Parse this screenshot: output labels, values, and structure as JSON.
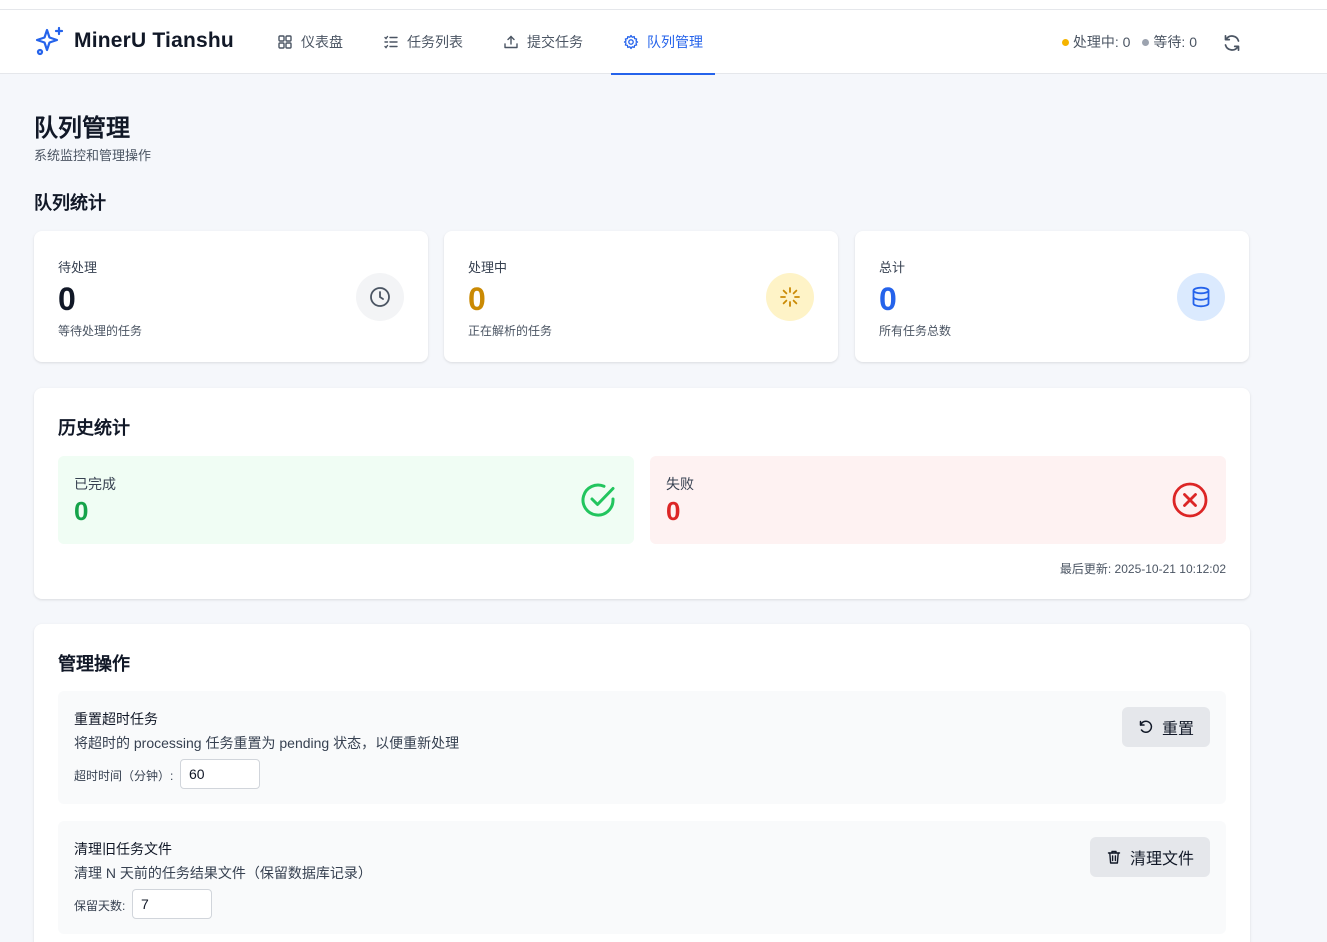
{
  "app": {
    "name": "MinerU Tianshu"
  },
  "nav": {
    "items": [
      {
        "label": "仪表盘",
        "icon": "dashboard-icon"
      },
      {
        "label": "任务列表",
        "icon": "list-icon"
      },
      {
        "label": "提交任务",
        "icon": "upload-icon"
      },
      {
        "label": "队列管理",
        "icon": "gear-icon",
        "active": true
      }
    ]
  },
  "header_status": {
    "processing": "处理中: 0",
    "pending": "等待: 0",
    "processing_color": "#f5b400",
    "pending_color": "#9ca3af"
  },
  "page": {
    "title": "队列管理",
    "subtitle": "系统监控和管理操作"
  },
  "queue_stats": {
    "title": "队列统计",
    "cards": [
      {
        "label": "待处理",
        "value": "0",
        "desc": "等待处理的任务",
        "icon": "clock-icon",
        "color": "#111827",
        "icon_bg": "#f3f4f6",
        "icon_color": "#4b5563"
      },
      {
        "label": "处理中",
        "value": "0",
        "desc": "正在解析的任务",
        "icon": "loader-icon",
        "color": "#ca8a04",
        "icon_bg": "#fef3c7",
        "icon_color": "#ca8a04"
      },
      {
        "label": "总计",
        "value": "0",
        "desc": "所有任务总数",
        "icon": "database-icon",
        "color": "#2563eb",
        "icon_bg": "#dbeafe",
        "icon_color": "#2563eb"
      }
    ]
  },
  "history": {
    "title": "历史统计",
    "completed": {
      "label": "已完成",
      "value": "0",
      "color": "#16a34a",
      "bg": "#f0fdf4"
    },
    "failed": {
      "label": "失败",
      "value": "0",
      "color": "#dc2626",
      "bg": "#fef2f2"
    },
    "last_update": "最后更新: 2025-10-21 10:12:02"
  },
  "operations": {
    "title": "管理操作",
    "reset": {
      "title": "重置超时任务",
      "desc": "将超时的 processing 任务重置为 pending 状态，以便重新处理",
      "field_label": "超时时间（分钟）:",
      "value": "60",
      "button": "重置"
    },
    "cleanup": {
      "title": "清理旧任务文件",
      "desc": "清理 N 天前的任务结果文件（保留数据库记录）",
      "field_label": "保留天数:",
      "value": "7",
      "button": "清理文件"
    }
  }
}
